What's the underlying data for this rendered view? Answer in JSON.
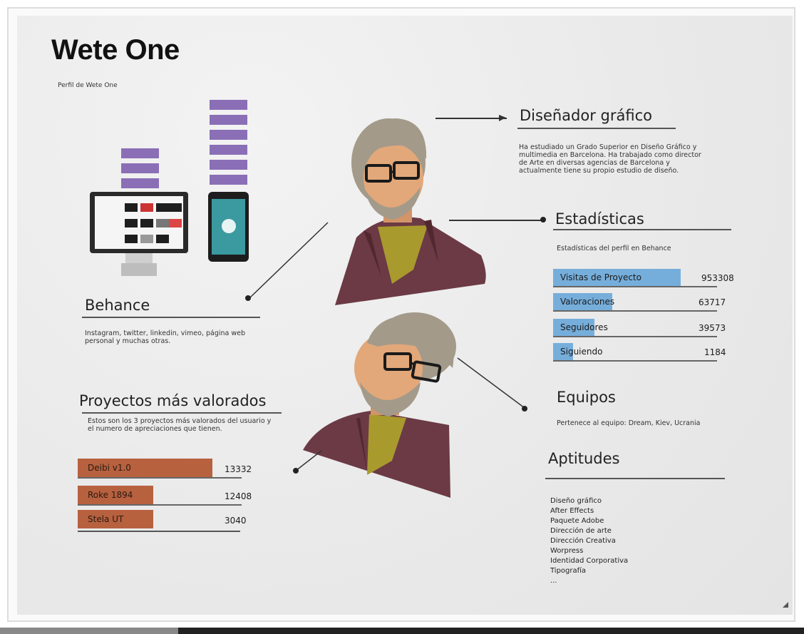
{
  "header": {
    "title": "Wete One",
    "subtitle": "Perfil de Wete One"
  },
  "designer": {
    "heading": "Diseñador gráfico",
    "text": "Ha estudiado un Grado Superior en Diseño Gráfico y multimedia en Barcelona. Ha trabajado como director de Arte en diversas agencias de Barcelona y actualmente tiene su propio estudio de diseño."
  },
  "stats": {
    "heading": "Estadísticas",
    "subheading": "Estadísticas del perfil en Behance",
    "rows": [
      {
        "label": "Visitas de Proyecto",
        "value": "953308",
        "fraction": 0.78
      },
      {
        "label": "Valoraciones",
        "value": "63717",
        "fraction": 0.36
      },
      {
        "label": "Seguidores",
        "value": "39573",
        "fraction": 0.25
      },
      {
        "label": "Siguiendo",
        "value": "1184",
        "fraction": 0.12
      }
    ]
  },
  "behance": {
    "heading": "Behance",
    "text": "Instagram, twitter, linkedin, vimeo, página web personal y muchas otras."
  },
  "projects": {
    "heading": "Proyectos más valorados",
    "text": "Estos son los 3 proyectos más valorados del usuario y el numero de apreciaciones que tienen.",
    "rows": [
      {
        "label": "Deibi v1.0",
        "value": "13332",
        "fraction": 0.82
      },
      {
        "label": "Roke 1894",
        "value": "12408",
        "fraction": 0.46
      },
      {
        "label": "Stela UT",
        "value": "3040",
        "fraction": 0.46
      }
    ]
  },
  "teams": {
    "heading": "Equipos",
    "text": "Pertenece al equipo: Dream, Kiev, Ucrania"
  },
  "skills": {
    "heading": "Aptitudes",
    "items": [
      "Diseño gráfico",
      "After Effects",
      "Paquete Adobe",
      "Dirección de arte",
      "Dirección Creativa",
      "Worpress",
      "Identidad Corporativa",
      "Tipografía",
      "..."
    ]
  },
  "colors": {
    "accent_purple": "#8a6fb6",
    "stat_blue": "#76aedb",
    "project_orange": "#b8613f",
    "jacket": "#6b3a45",
    "shirt": "#a99a2e",
    "skin": "#e2a87a",
    "hair": "#a39a8a"
  }
}
